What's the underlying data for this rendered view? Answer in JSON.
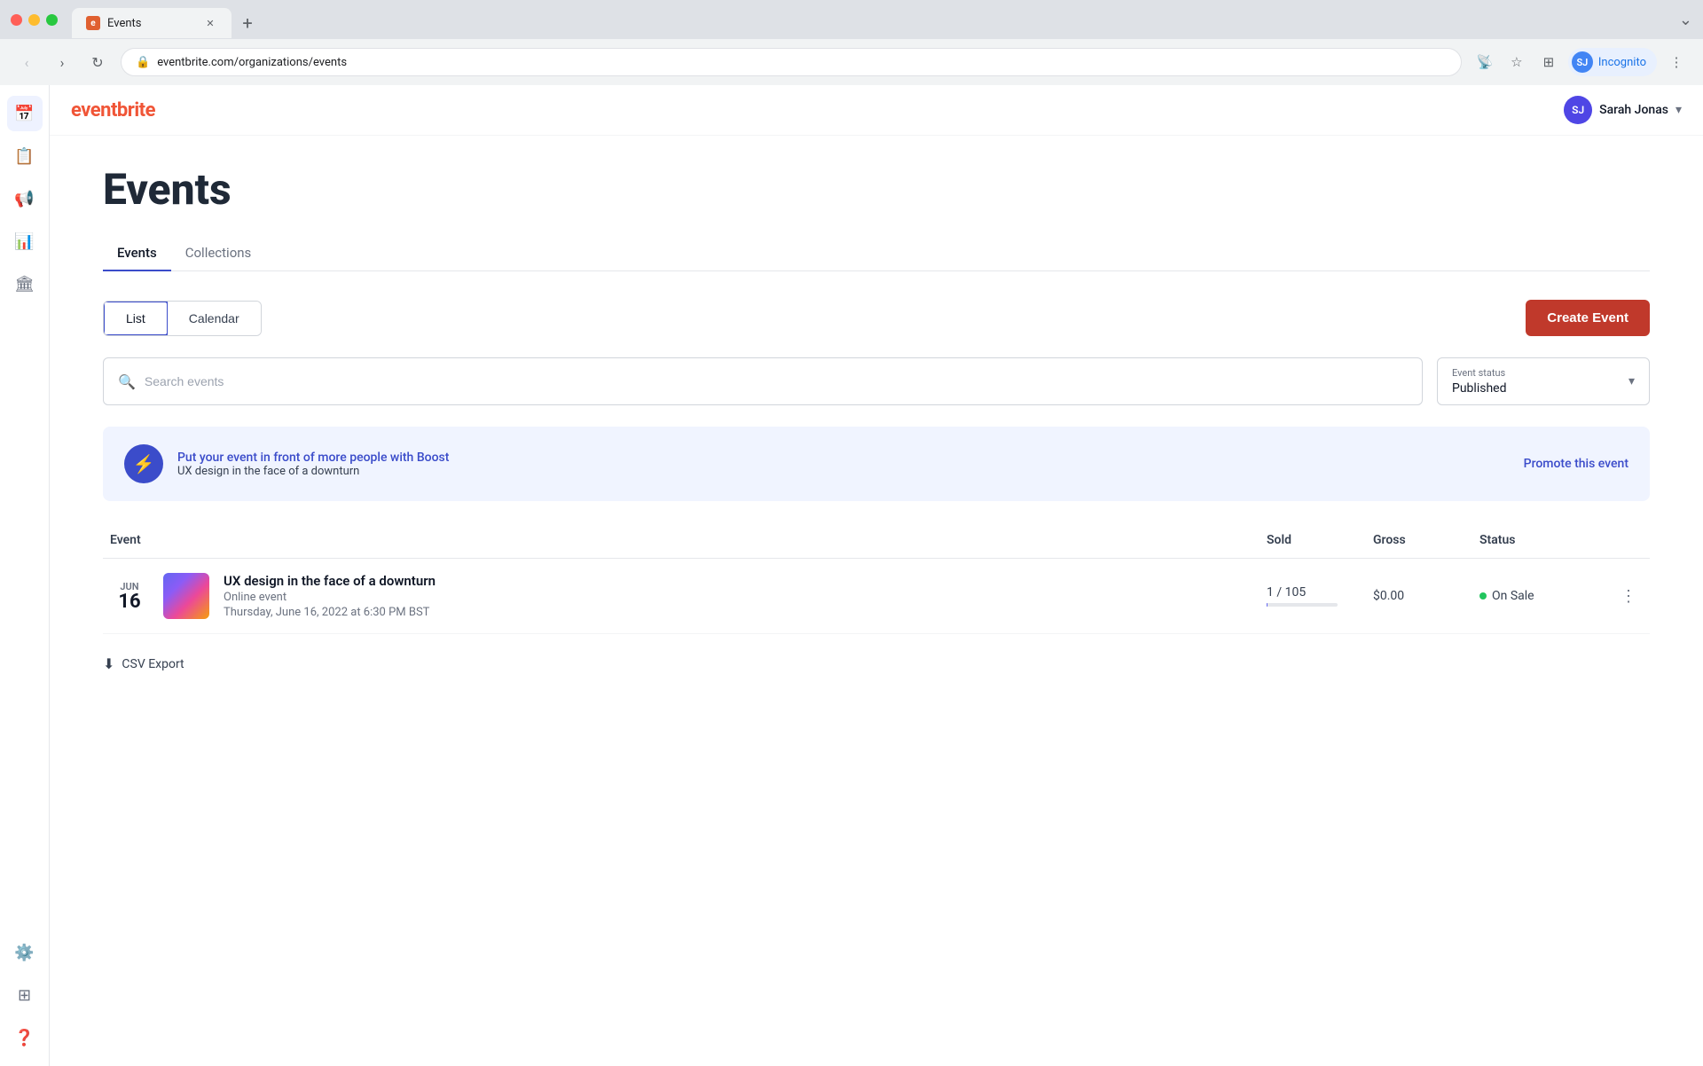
{
  "browser": {
    "tab_title": "Events",
    "tab_favicon": "E",
    "url": "eventbrite.com/organizations/events",
    "profile_initials": "SJ",
    "profile_name": "Incognito"
  },
  "app": {
    "logo": "eventbrite",
    "user_name": "Sarah Jonas",
    "user_initials": "SJ"
  },
  "sidebar": {
    "items": [
      {
        "id": "calendar",
        "icon": "📅",
        "active": true
      },
      {
        "id": "orders",
        "icon": "📋",
        "active": false
      },
      {
        "id": "marketing",
        "icon": "📢",
        "active": false
      },
      {
        "id": "analytics",
        "icon": "📊",
        "active": false
      },
      {
        "id": "venue",
        "icon": "🏛",
        "active": false
      },
      {
        "id": "settings",
        "icon": "⚙️",
        "active": false
      },
      {
        "id": "help",
        "icon": "❓",
        "active": false
      }
    ]
  },
  "page": {
    "title": "Events",
    "tabs": [
      {
        "id": "events",
        "label": "Events",
        "active": true
      },
      {
        "id": "collections",
        "label": "Collections",
        "active": false
      }
    ]
  },
  "view_controls": {
    "list_label": "List",
    "calendar_label": "Calendar",
    "create_event_label": "Create Event"
  },
  "search": {
    "placeholder": "Search events"
  },
  "status_filter": {
    "label": "Event status",
    "value": "Published"
  },
  "boost_banner": {
    "main_text": "Put your event in front of more people with Boost",
    "sub_text": "UX design in the face of a downturn",
    "promote_label": "Promote this event"
  },
  "table": {
    "headers": [
      "Event",
      "Sold",
      "Gross",
      "Status"
    ],
    "rows": [
      {
        "month": "JUN",
        "day": "16",
        "name": "UX design in the face of a downturn",
        "type": "Online event",
        "datetime": "Thursday, June 16, 2022 at 6:30 PM BST",
        "sold": "1 / 105",
        "gross": "$0.00",
        "status": "On Sale",
        "status_color": "#22c55e"
      }
    ]
  },
  "csv_export": {
    "label": "CSV Export"
  },
  "colors": {
    "brand": "#f05537",
    "accent": "#3b4cca",
    "create_btn": "#c0392b"
  }
}
